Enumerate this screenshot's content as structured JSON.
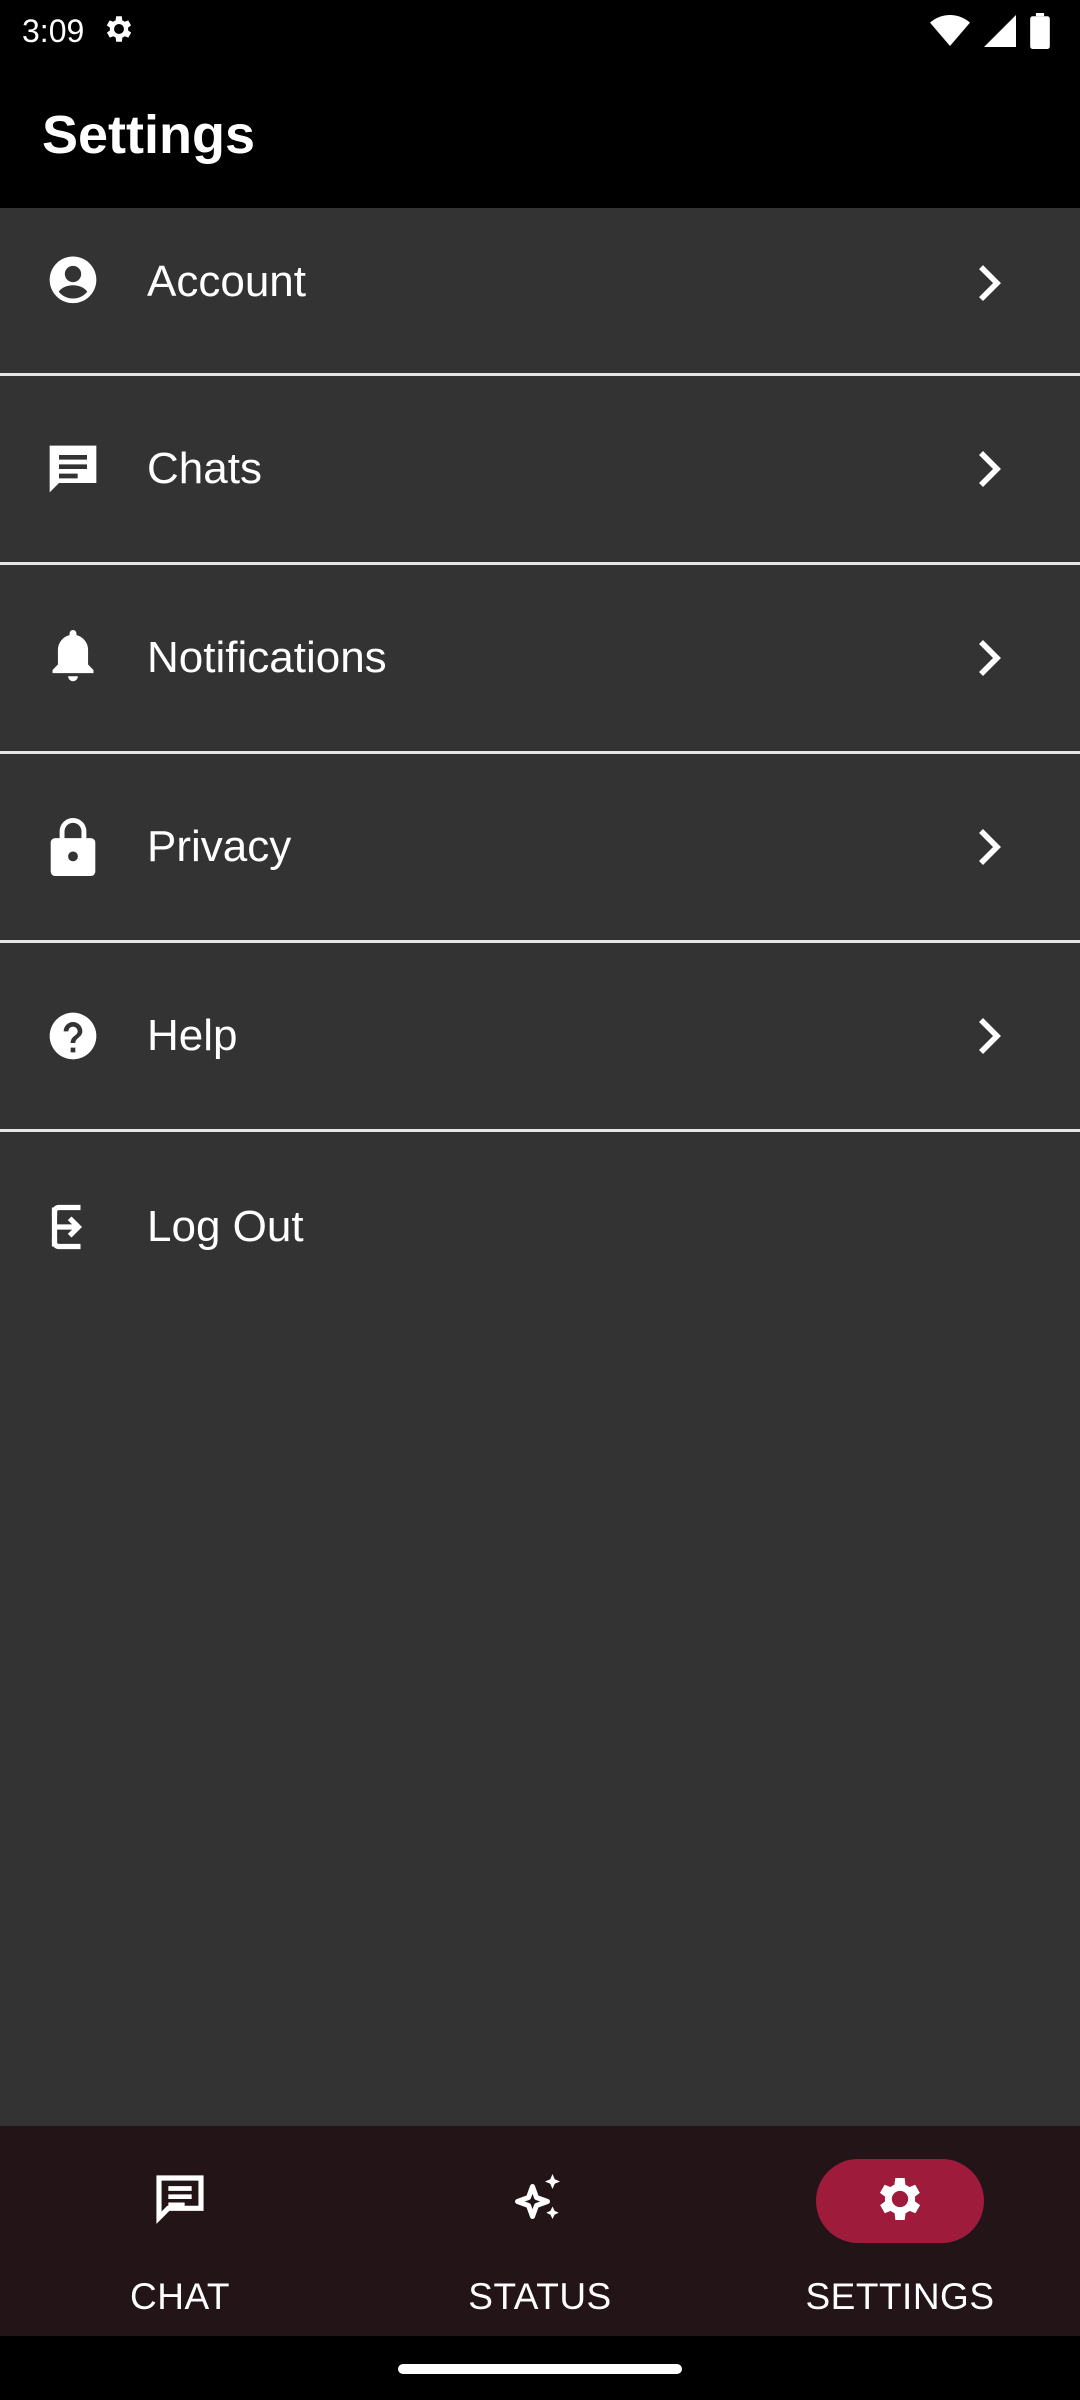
{
  "status_bar": {
    "time": "3:09",
    "icons": [
      "settings-gear-icon",
      "wifi-icon",
      "cell-signal-icon",
      "battery-icon"
    ]
  },
  "app_bar": {
    "title": "Settings"
  },
  "settings": {
    "items": [
      {
        "label": "Account",
        "icon": "account-circle-icon"
      },
      {
        "label": "Chats",
        "icon": "chat-bubble-icon"
      },
      {
        "label": "Notifications",
        "icon": "bell-icon"
      },
      {
        "label": "Privacy",
        "icon": "lock-icon"
      },
      {
        "label": "Help",
        "icon": "help-circle-icon"
      }
    ],
    "logout": {
      "label": "Log Out",
      "icon": "logout-icon"
    }
  },
  "bottom_nav": {
    "items": [
      {
        "label": "CHAT",
        "icon": "chat-icon",
        "active": false
      },
      {
        "label": "STATUS",
        "icon": "sparkle-icon",
        "active": false
      },
      {
        "label": "SETTINGS",
        "icon": "gear-icon",
        "active": true
      }
    ]
  },
  "colors": {
    "background": "#000000",
    "content_bg": "#333333",
    "divider": "#e6e6e6",
    "nav_bg": "#231418",
    "active_pill": "#9e1b3c",
    "text": "#ffffff"
  }
}
